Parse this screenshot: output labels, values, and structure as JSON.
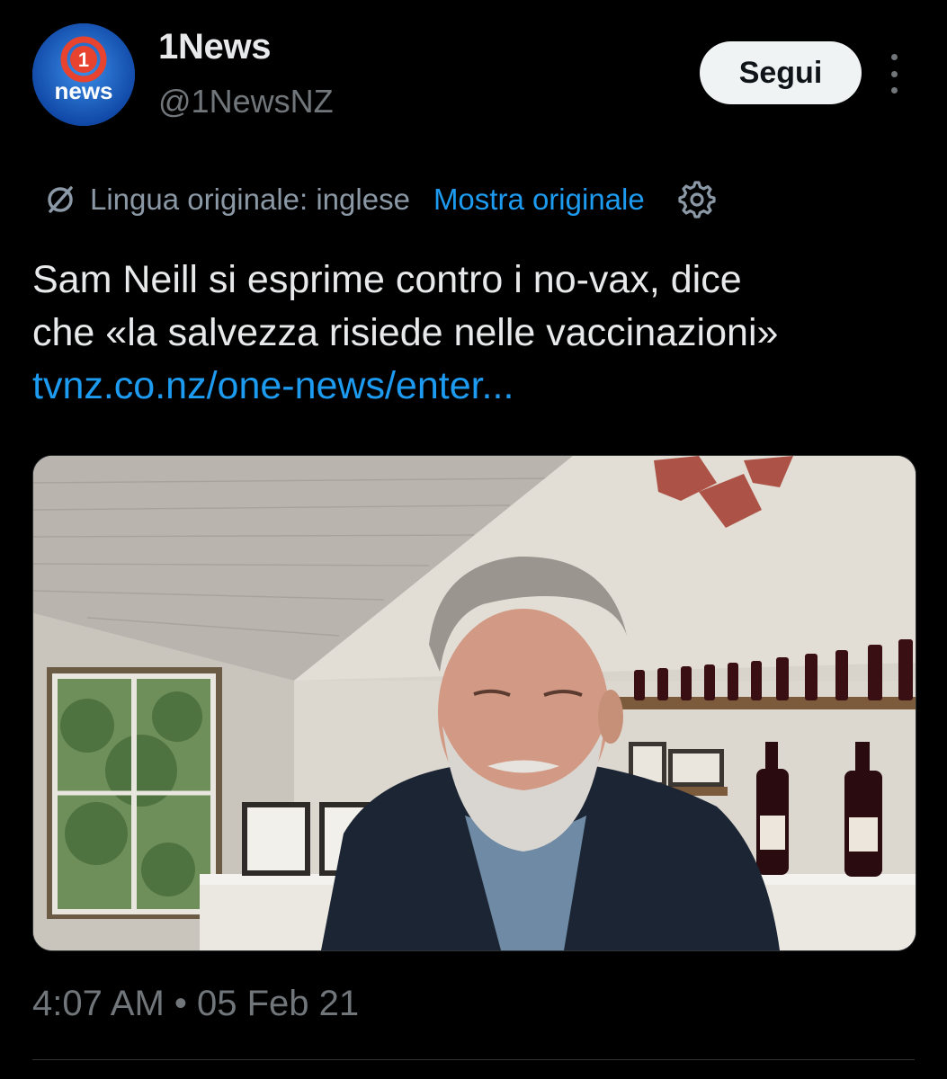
{
  "account": {
    "display_name": "1News",
    "handle": "@1NewsNZ",
    "avatar_logo_text": "news",
    "avatar_logo_number": "1"
  },
  "actions": {
    "follow_label": "Segui",
    "more_icon": "more-vertical-icon"
  },
  "translation": {
    "original_language_label": "Lingua originale: inglese",
    "show_original_label": "Mostra originale",
    "settings_icon": "gear-icon"
  },
  "tweet": {
    "text_line_1": "Sam Neill si esprime contro i no-vax, dice",
    "text_line_2": "che «la salvezza risiede nelle vaccinazioni»",
    "link": "tvnz.co.nz/one-news/enter..."
  },
  "meta": {
    "timestamp": "4:07 AM • 05 Feb 21"
  },
  "colors": {
    "background": "#000000",
    "primary_text": "#e7e9ea",
    "secondary_text": "#71767b",
    "link": "#1d9bf0",
    "follow_button_bg": "#eff3f4"
  }
}
